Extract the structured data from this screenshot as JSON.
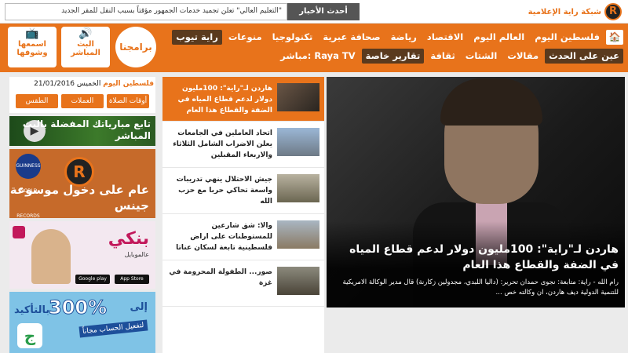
{
  "topbar": {
    "ticker_text": "\"التعليم العالي\" تعلن تجميد خدمات الجمهور مؤقتاً بسبب النقل للمقر الجديد",
    "latest_news_label": "أحدث الأخبار",
    "logo_text": "شبكة راية الإعلامية",
    "logo_letter": "R"
  },
  "header": {
    "live_audio_label": "البث المباشر",
    "watch_listen_label": "اسمعها وشوفها",
    "programs_label": "برامجنا",
    "nav_row1": [
      {
        "label": "فلسطين اليوم"
      },
      {
        "label": "العالم اليوم"
      },
      {
        "label": "الاقتصاد"
      },
      {
        "label": "رياضة"
      },
      {
        "label": "صحافة عبرية"
      },
      {
        "label": "تكنولوجيا"
      },
      {
        "label": "منوعات"
      },
      {
        "label": "راية تيوب"
      }
    ],
    "nav_row2": [
      {
        "label": "عين على الحدث"
      },
      {
        "label": "مقالات"
      },
      {
        "label": "الشتات"
      },
      {
        "label": "ثقافة"
      },
      {
        "label": "تقارير خاصة"
      },
      {
        "label": "مباشر: Raya TV"
      }
    ]
  },
  "sidebar": {
    "date_section": "فلسطين اليوم",
    "date_text": "الخميس 21/01/2016",
    "utilities": [
      {
        "label": "الطقس"
      },
      {
        "label": "العملات"
      },
      {
        "label": "أوقات الصلاة"
      }
    ],
    "ad_live_matches": "تابع مبارياتك المفضلة بالبث المباشر",
    "ad_guinness": "عام على دخول موسوعة جينس",
    "ad_guinness_badge": "GUINNESS WORLD RECORDS",
    "ad_banki_brand": "بنكي",
    "ad_banki_sub": "عالموبايل",
    "ad_store_google": "Google play",
    "ad_store_apple": "App Store",
    "ad_percent": "300%",
    "ad_percent_pre": "إلى",
    "ad_percent_after": "بالتأكيد",
    "ad_percent_badge": "لتفعيل الحساب مجاناً",
    "colors": {
      "accent": "#e8731b",
      "dark_nav": "#5a3a1e"
    }
  },
  "news_list": [
    {
      "title": "هاردن لـ\"راية\": 100مليون دولار لدعم قطاع المياه في الضفة والقطاع هذا العام",
      "active": true
    },
    {
      "title": "اتحاد العاملين في الجامعات يعلن الاضراب الشامل الثلاثاء والاربعاء المقبلين",
      "active": false
    },
    {
      "title": "جيش الاحتلال ينهي تدريبات واسعة تحاكي حربا مع حزب الله",
      "active": false
    },
    {
      "title": "والا: شق شارعين للمستوطنات على اراض فلسطينية تابعة لسكان عناتا",
      "active": false
    },
    {
      "title": "صور... الطفولة المحرومة في غزة",
      "active": false
    }
  ],
  "feature": {
    "title": "هاردن لـ\"راية\": 100مليون دولار لدعم قطاع المياه في الضفة والقطاع هذا العام",
    "summary": "رام الله - راية: متابعة: نجوى حمدان تحرير: (داليا اللبدي، مجدولين زكارنة) قال مدير الوكالة الامريكية للتنمية الدولية ديف هاردن، ان وكالته خص ..."
  }
}
